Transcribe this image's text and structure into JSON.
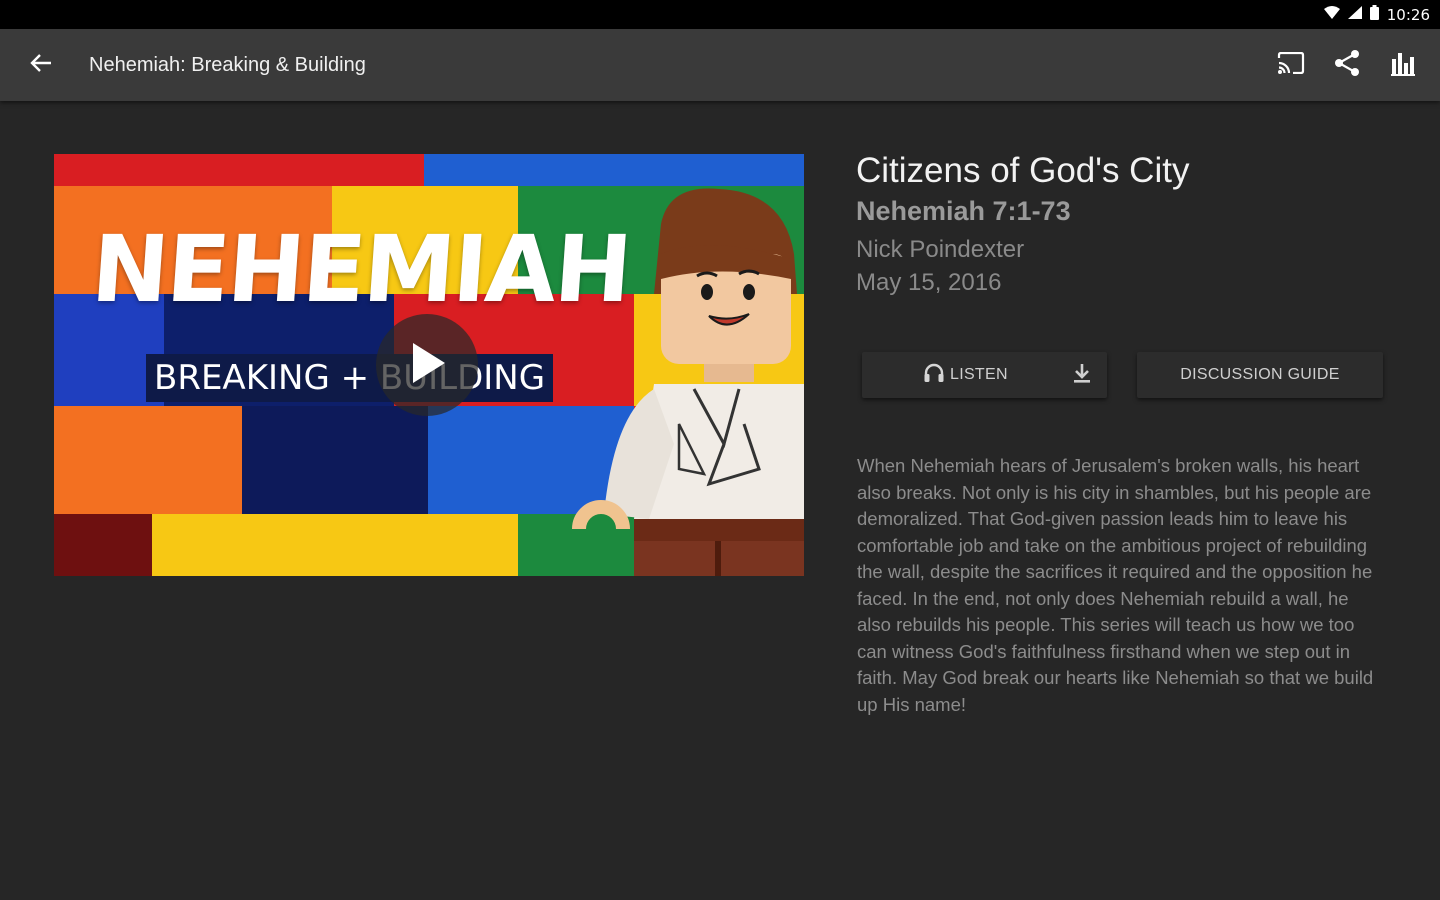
{
  "status_bar": {
    "time": "10:26",
    "wifi_icon": "wifi-icon",
    "signal_icon": "signal-icon",
    "battery_icon": "battery-icon"
  },
  "app_bar": {
    "title": "Nehemiah: Breaking & Building",
    "back_icon": "arrow-back-icon",
    "actions": [
      "cast-icon",
      "share-icon",
      "chart-icon"
    ]
  },
  "thumbnail": {
    "title": "NEHEMIAH",
    "subtitle": "BREAKING + BUILDING",
    "play_icon": "play-icon"
  },
  "sermon": {
    "title": "Citizens of God's City",
    "scripture": "Nehemiah 7:1-73",
    "speaker": "Nick Poindexter",
    "date": "May 15, 2016"
  },
  "buttons": {
    "listen_label": "LISTEN",
    "listen_icon": "headphones-icon",
    "download_icon": "download-icon",
    "guide_label": "DISCUSSION GUIDE"
  },
  "description": "When Nehemiah hears of Jerusalem's broken walls, his heart also breaks. Not only is his city in shambles, but his people are demoralized. That God-given passion leads him to leave his comfortable job and take on the ambitious project of rebuilding the wall, despite the sacrifices it required and the opposition he faced. In the end, not only does Nehemiah rebuild a wall, he also rebuilds his people. This series will teach us how we too can witness God's faithfulness firsthand when we step out in faith. May God break our hearts like Nehemiah so that we build up His name!",
  "colors": {
    "background": "#262626",
    "app_bar": "#3a3a3a",
    "status_bar": "#000000"
  }
}
